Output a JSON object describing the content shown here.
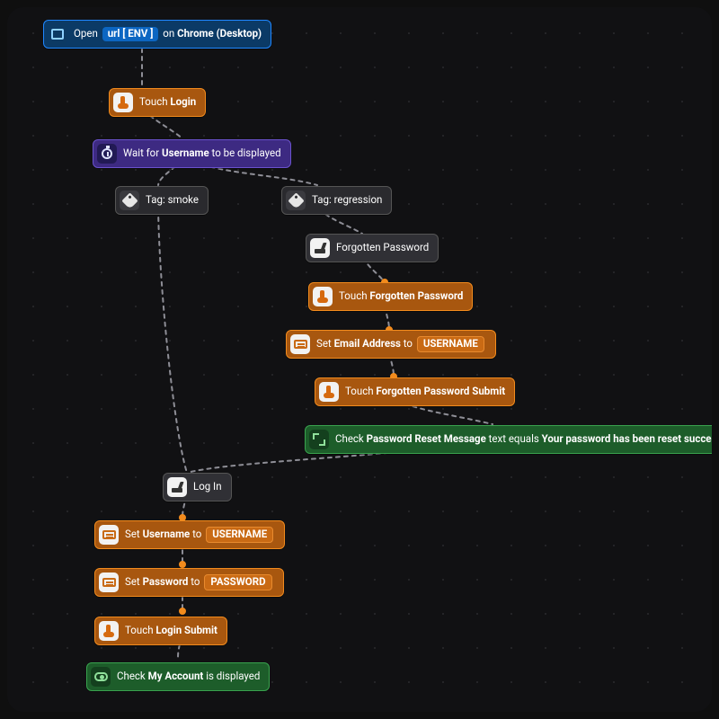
{
  "colors": {
    "blue": "#0b3a66",
    "orange": "#a8570f",
    "purple": "#3d2a82",
    "gray": "#2a2a2e",
    "green": "#1d5d2a"
  },
  "nodes": {
    "open": {
      "pre": "Open",
      "url_pill": "url [ ENV ]",
      "mid": "on",
      "target": "Chrome (Desktop)"
    },
    "touch_login": {
      "action": "Touch",
      "target": "Login"
    },
    "wait_username": {
      "pre": "Wait for",
      "target": "Username",
      "post": "to be displayed"
    },
    "tag_smoke": {
      "label": "Tag: smoke"
    },
    "tag_regression": {
      "label": "Tag: regression"
    },
    "forgot_group": {
      "label": "Forgotten Password"
    },
    "touch_forgot": {
      "action": "Touch",
      "target": "Forgotten Password"
    },
    "set_email": {
      "action": "Set",
      "field": "Email Address",
      "mid": "to",
      "value": "USERNAME"
    },
    "touch_forgot_submit": {
      "action": "Touch",
      "target": "Forgotten Password Submit"
    },
    "check_reset": {
      "action": "Check",
      "field": "Password Reset Message",
      "mid": "text equals",
      "value": "Your password has been reset successfully!"
    },
    "login_group": {
      "label": "Log In"
    },
    "set_username": {
      "action": "Set",
      "field": "Username",
      "mid": "to",
      "value": "USERNAME"
    },
    "set_password": {
      "action": "Set",
      "field": "Password",
      "mid": "to",
      "value": "PASSWORD"
    },
    "touch_login_submit": {
      "action": "Touch",
      "target": "Login Submit"
    },
    "check_account": {
      "action": "Check",
      "field": "My Account",
      "post": "is displayed"
    }
  }
}
